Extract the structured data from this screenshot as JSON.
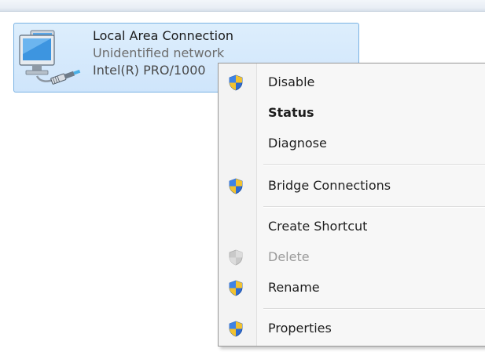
{
  "connection": {
    "name": "Local Area Connection",
    "status": "Unidentified network",
    "adapter": "Intel(R) PRO/1000",
    "icon": "network-adapter-icon"
  },
  "context_menu": {
    "items": [
      {
        "label": "Disable",
        "icon": "uac-shield-icon"
      },
      {
        "label": "Status"
      },
      {
        "label": "Diagnose"
      },
      {
        "label": "Bridge Connections",
        "icon": "uac-shield-icon"
      },
      {
        "label": "Create Shortcut"
      },
      {
        "label": "Delete",
        "icon": "uac-shield-icon",
        "state": "disabled"
      },
      {
        "label": "Rename",
        "icon": "uac-shield-icon"
      },
      {
        "label": "Properties",
        "icon": "uac-shield-icon"
      }
    ]
  },
  "colors": {
    "selection_bg": "#cfe5fb",
    "selection_border": "#7ab2e3",
    "menu_bg": "#f7f7f7",
    "shield_blue": "#2f6bd0",
    "shield_yellow": "#f2c230"
  }
}
